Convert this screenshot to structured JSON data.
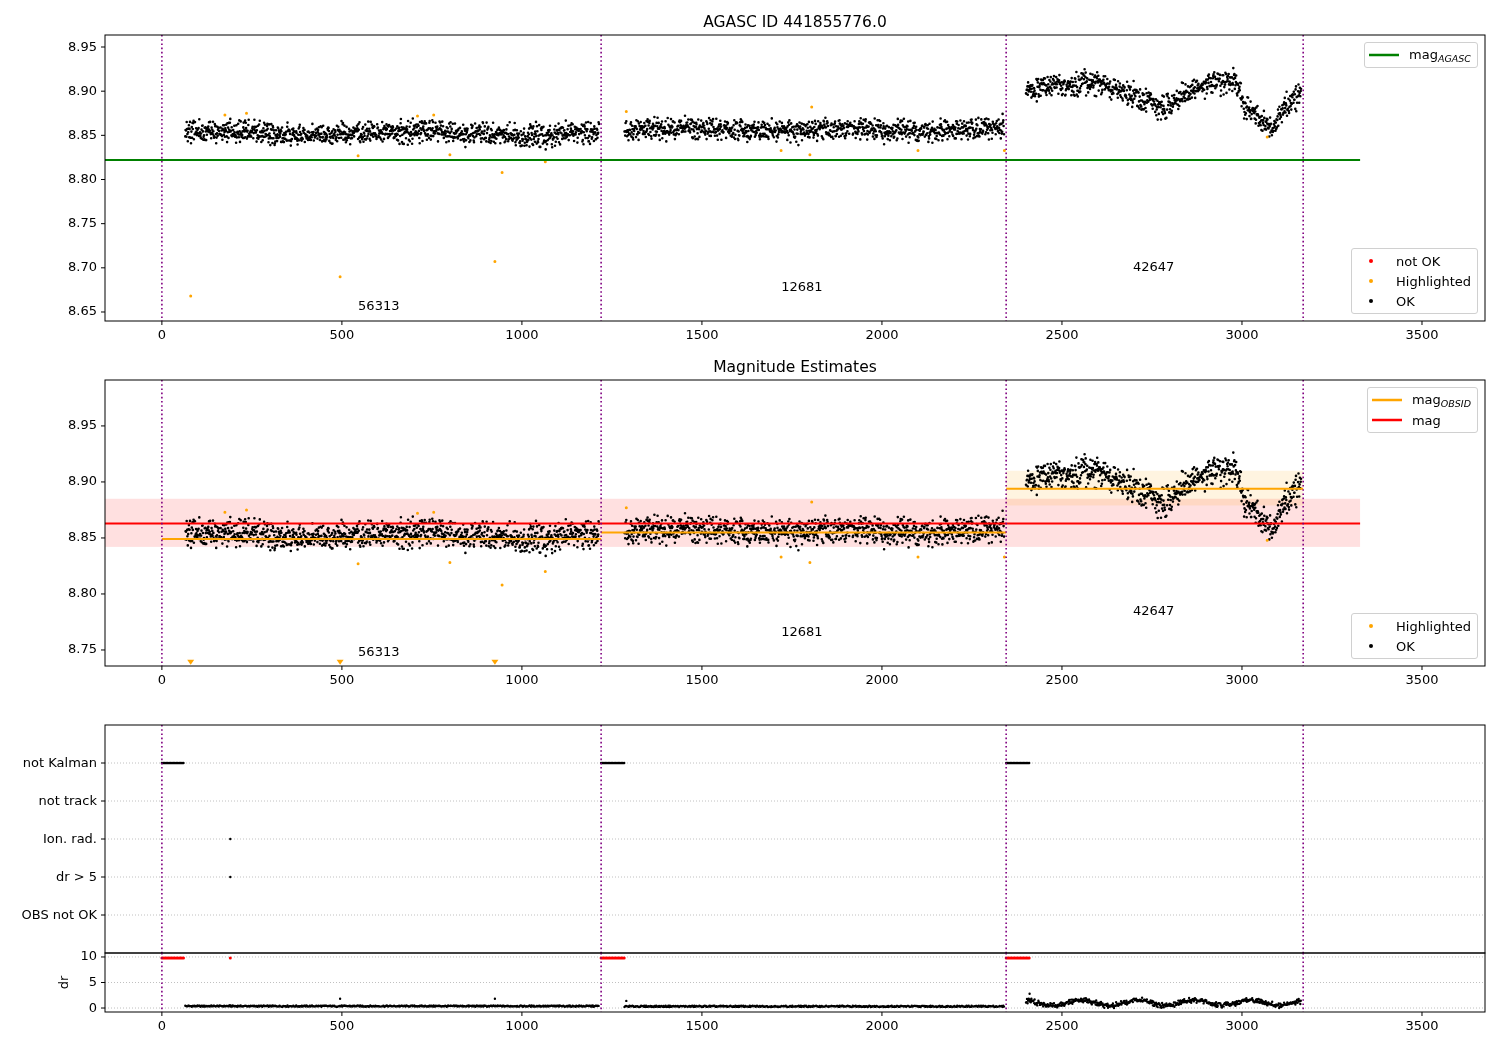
{
  "figure": {
    "panels": [
      {
        "kind": "mag",
        "point_legend": [
          {
            "label": "not OK",
            "color": "#ff0000"
          },
          {
            "label": "Highlighted",
            "color": "#ffa500"
          },
          {
            "label": "OK",
            "color": "#000000"
          }
        ],
        "chart_data": {
          "type": "scatter",
          "title": "AGASC ID 441855776.0",
          "legend": "right",
          "xlim": [
            -158,
            3675
          ],
          "ylim": [
            8.6398,
            8.9636
          ],
          "xticks": [
            0,
            500,
            1000,
            1500,
            2000,
            2500,
            3000,
            3500
          ],
          "yticks": [
            {
              "value": 8.65,
              "label": "8.65"
            },
            {
              "value": 8.7,
              "label": "8.70"
            },
            {
              "value": 8.75,
              "label": "8.75"
            },
            {
              "value": 8.8,
              "label": "8.80"
            },
            {
              "value": 8.85,
              "label": "8.85"
            },
            {
              "value": 8.9,
              "label": "8.90"
            },
            {
              "value": 8.95,
              "label": "8.95"
            }
          ],
          "series": [
            {
              "name": "mag$_{AGASC}$",
              "type": "line",
              "color": "#008000",
              "x": [
                -158,
                3328
              ],
              "values": [
                8.822,
                8.822
              ]
            }
          ],
          "ref_lines": [
            {
              "axis": "x",
              "value": 0
            },
            {
              "axis": "x",
              "value": 1220
            },
            {
              "axis": "x",
              "value": 2345
            },
            {
              "axis": "x",
              "value": 3170
            }
          ],
          "annotations": [
            "56313",
            "12681",
            "42647"
          ]
        }
      },
      {
        "kind": "mag",
        "point_legend": [
          {
            "label": "Highlighted",
            "color": "#ffa500"
          },
          {
            "label": "OK",
            "color": "#000000"
          }
        ],
        "chart_data": {
          "type": "scatter",
          "title": "Magnitude Estimates",
          "legend": "right",
          "xlim": [
            -158,
            3675
          ],
          "ylim": [
            8.7357,
            8.991
          ],
          "xticks": [
            0,
            500,
            1000,
            1500,
            2000,
            2500,
            3000,
            3500
          ],
          "yticks": [
            {
              "value": 8.75,
              "label": "8.75"
            },
            {
              "value": 8.8,
              "label": "8.80"
            },
            {
              "value": 8.85,
              "label": "8.85"
            },
            {
              "value": 8.9,
              "label": "8.90"
            },
            {
              "value": 8.95,
              "label": "8.95"
            }
          ],
          "series": [
            {
              "name": "mag$_{OBSID}$",
              "type": "line",
              "color": "#ffa500",
              "x": [
                0,
                1220,
                null,
                1220,
                2345,
                null,
                2345,
                3170
              ],
              "values": [
                8.849,
                8.849,
                null,
                8.855,
                8.855,
                null,
                8.894,
                8.894
              ]
            },
            {
              "name": "mag",
              "type": "line",
              "color": "#ff0000",
              "x": [
                -158,
                3328
              ],
              "values": [
                8.863,
                8.863
              ]
            },
            {
              "type": "scatter",
              "marker": "triangle",
              "color": "#ffa500",
              "x": [
                80,
                495,
                925
              ],
              "values": [
                8.739,
                8.739,
                8.739
              ]
            }
          ],
          "bands": [
            {
              "axis": "y",
              "from": 8.842,
              "to": 8.885,
              "color": "#ff0000"
            },
            {
              "axis": "y",
              "from": 8.879,
              "to": 8.91,
              "color": "#ffa500"
            }
          ],
          "ref_lines": [
            {
              "axis": "x",
              "value": 0
            },
            {
              "axis": "x",
              "value": 1220
            },
            {
              "axis": "x",
              "value": 2345
            },
            {
              "axis": "x",
              "value": 3170
            }
          ],
          "annotations": [
            "56313",
            "12681",
            "42647"
          ]
        }
      },
      {
        "kind": "flags",
        "rows": [
          "not Kalman",
          "not track",
          "Ion. rad.",
          "dr > 5",
          "OBS not OK"
        ]
      },
      {
        "kind": "dr",
        "chart_data": {
          "type": "scatter",
          "ylabel": "dr",
          "grid": true,
          "xlim": [
            -158,
            3675
          ],
          "ylim": [
            -0.78,
            10.78
          ],
          "xticks": [
            0,
            500,
            1000,
            1500,
            2000,
            2500,
            3000,
            3500
          ],
          "yticks": [
            0,
            5,
            10
          ],
          "ref_lines": [
            {
              "axis": "x",
              "value": 0
            },
            {
              "axis": "x",
              "value": 1220
            },
            {
              "axis": "x",
              "value": 2345
            },
            {
              "axis": "x",
              "value": 3170
            }
          ]
        }
      }
    ]
  }
}
